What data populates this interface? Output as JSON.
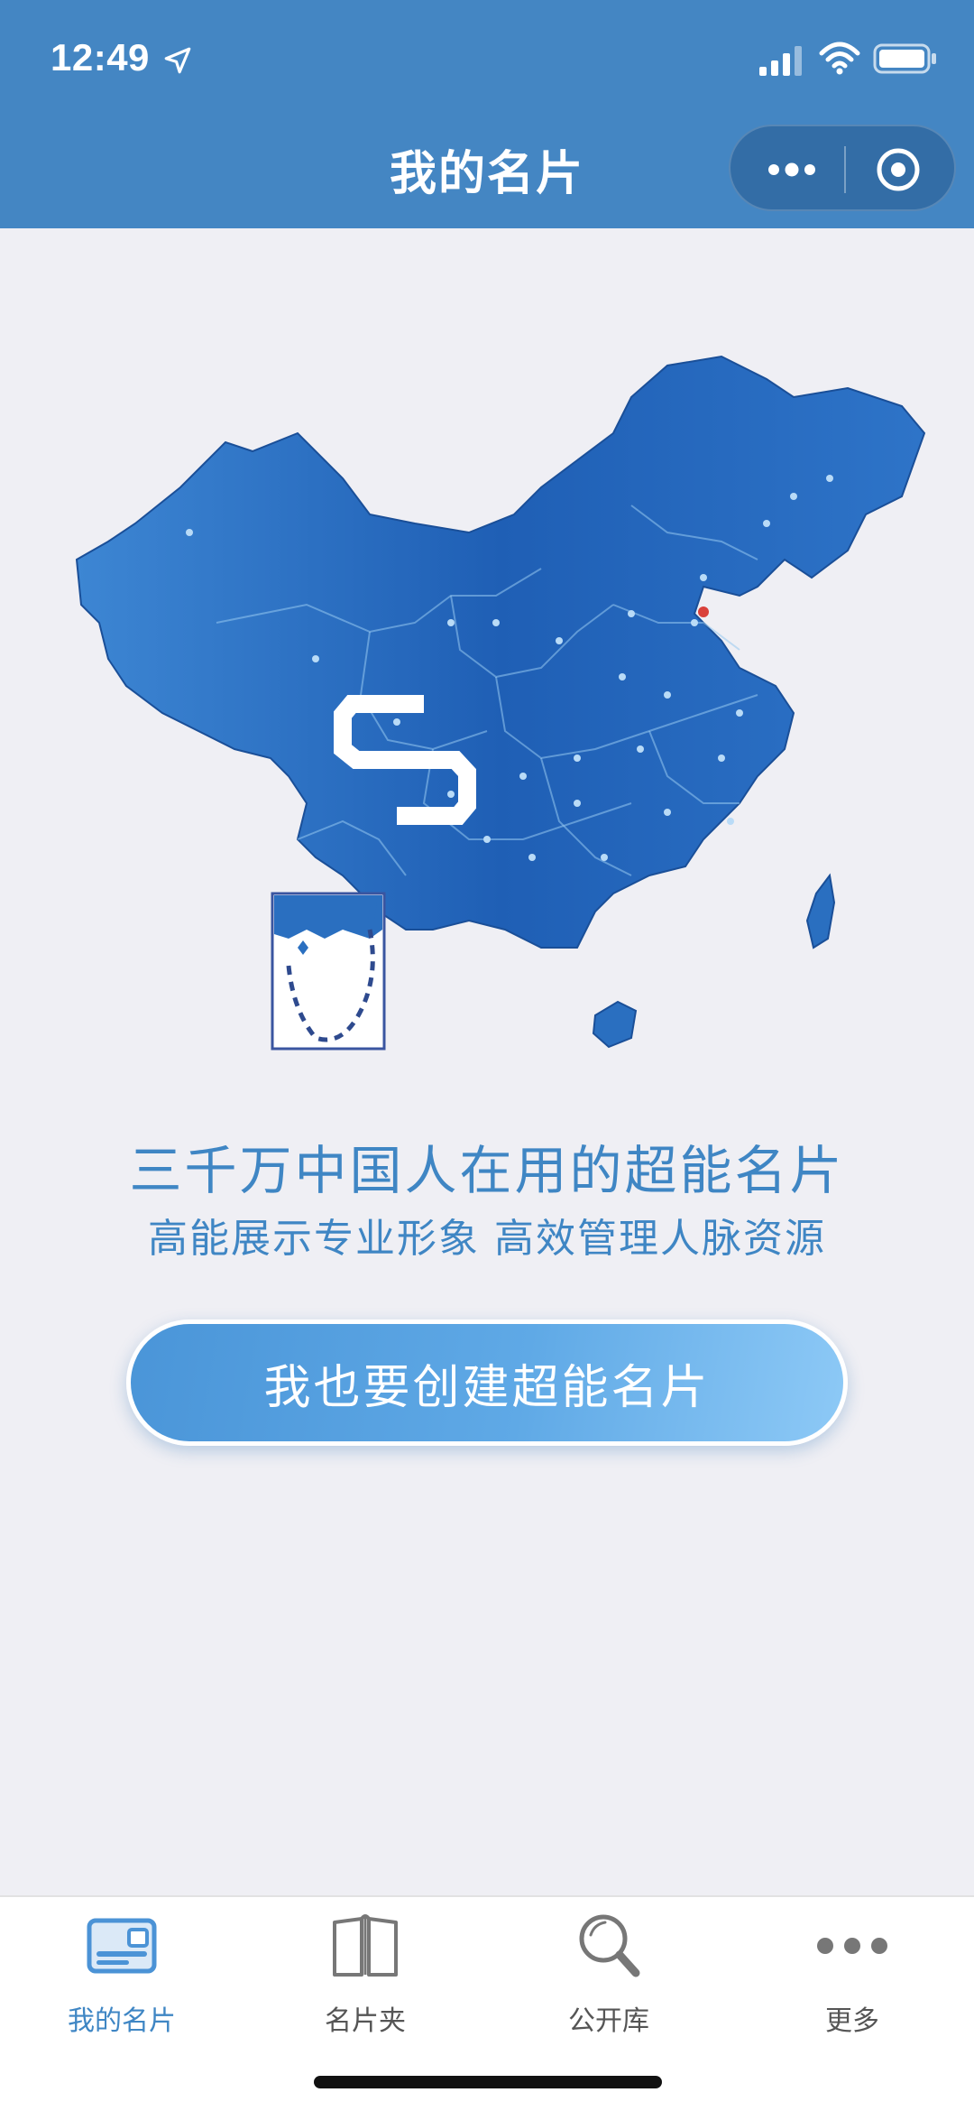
{
  "status_bar": {
    "time": "12:49"
  },
  "nav": {
    "title": "我的名片"
  },
  "hero": {
    "slogan_main": "三千万中国人在用的超能名片",
    "slogan_sub": "高能展示专业形象 高效管理人脉资源",
    "cta_label": "我也要创建超能名片"
  },
  "tab_bar": {
    "items": [
      {
        "label": "我的名片",
        "icon": "card-icon",
        "active": true
      },
      {
        "label": "名片夹",
        "icon": "book-icon",
        "active": false
      },
      {
        "label": "公开库",
        "icon": "search-icon",
        "active": false
      },
      {
        "label": "更多",
        "icon": "more-dots-icon",
        "active": false
      }
    ]
  },
  "colors": {
    "header_bg": "#4486c3",
    "accent": "#3f86c4",
    "page_bg": "#efeff4",
    "map_blue": "#2a6fc0"
  }
}
